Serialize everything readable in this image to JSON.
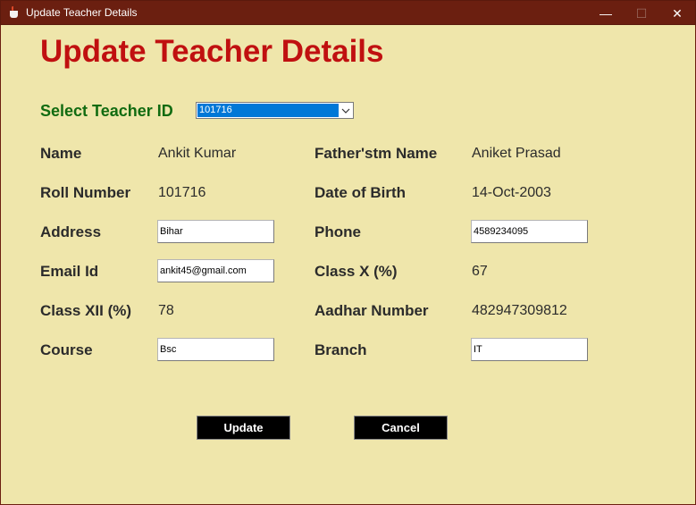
{
  "window": {
    "title": "Update Teacher Details",
    "minimize_glyph": "—",
    "maximize_glyph": "☐",
    "close_glyph": "✕"
  },
  "heading": "Update Teacher Details",
  "selector": {
    "label": "Select Teacher ID",
    "selected_value": "101716"
  },
  "fields": {
    "name": {
      "label": "Name",
      "value": "Ankit Kumar"
    },
    "father_name": {
      "label": "Father'stm Name",
      "value": "Aniket Prasad"
    },
    "roll_number": {
      "label": "Roll Number",
      "value": "101716"
    },
    "dob": {
      "label": "Date of Birth",
      "value": "14-Oct-2003"
    },
    "address": {
      "label": "Address",
      "value": "Bihar"
    },
    "phone": {
      "label": "Phone",
      "value": "4589234095"
    },
    "email": {
      "label": "Email Id",
      "value": "ankit45@gmail.com"
    },
    "class_x": {
      "label": "Class X (%)",
      "value": "67"
    },
    "class_xii": {
      "label": "Class XII (%)",
      "value": "78"
    },
    "aadhar": {
      "label": "Aadhar Number",
      "value": "482947309812"
    },
    "course": {
      "label": "Course",
      "value": "Bsc"
    },
    "branch": {
      "label": "Branch",
      "value": "IT"
    }
  },
  "buttons": {
    "update": "Update",
    "cancel": "Cancel"
  },
  "colors": {
    "titlebar": "#6b1f10",
    "background": "#efe6ab",
    "heading": "#c01010",
    "selector_label": "#116b11",
    "selection_highlight": "#0078d7",
    "button_bg": "#000000"
  }
}
